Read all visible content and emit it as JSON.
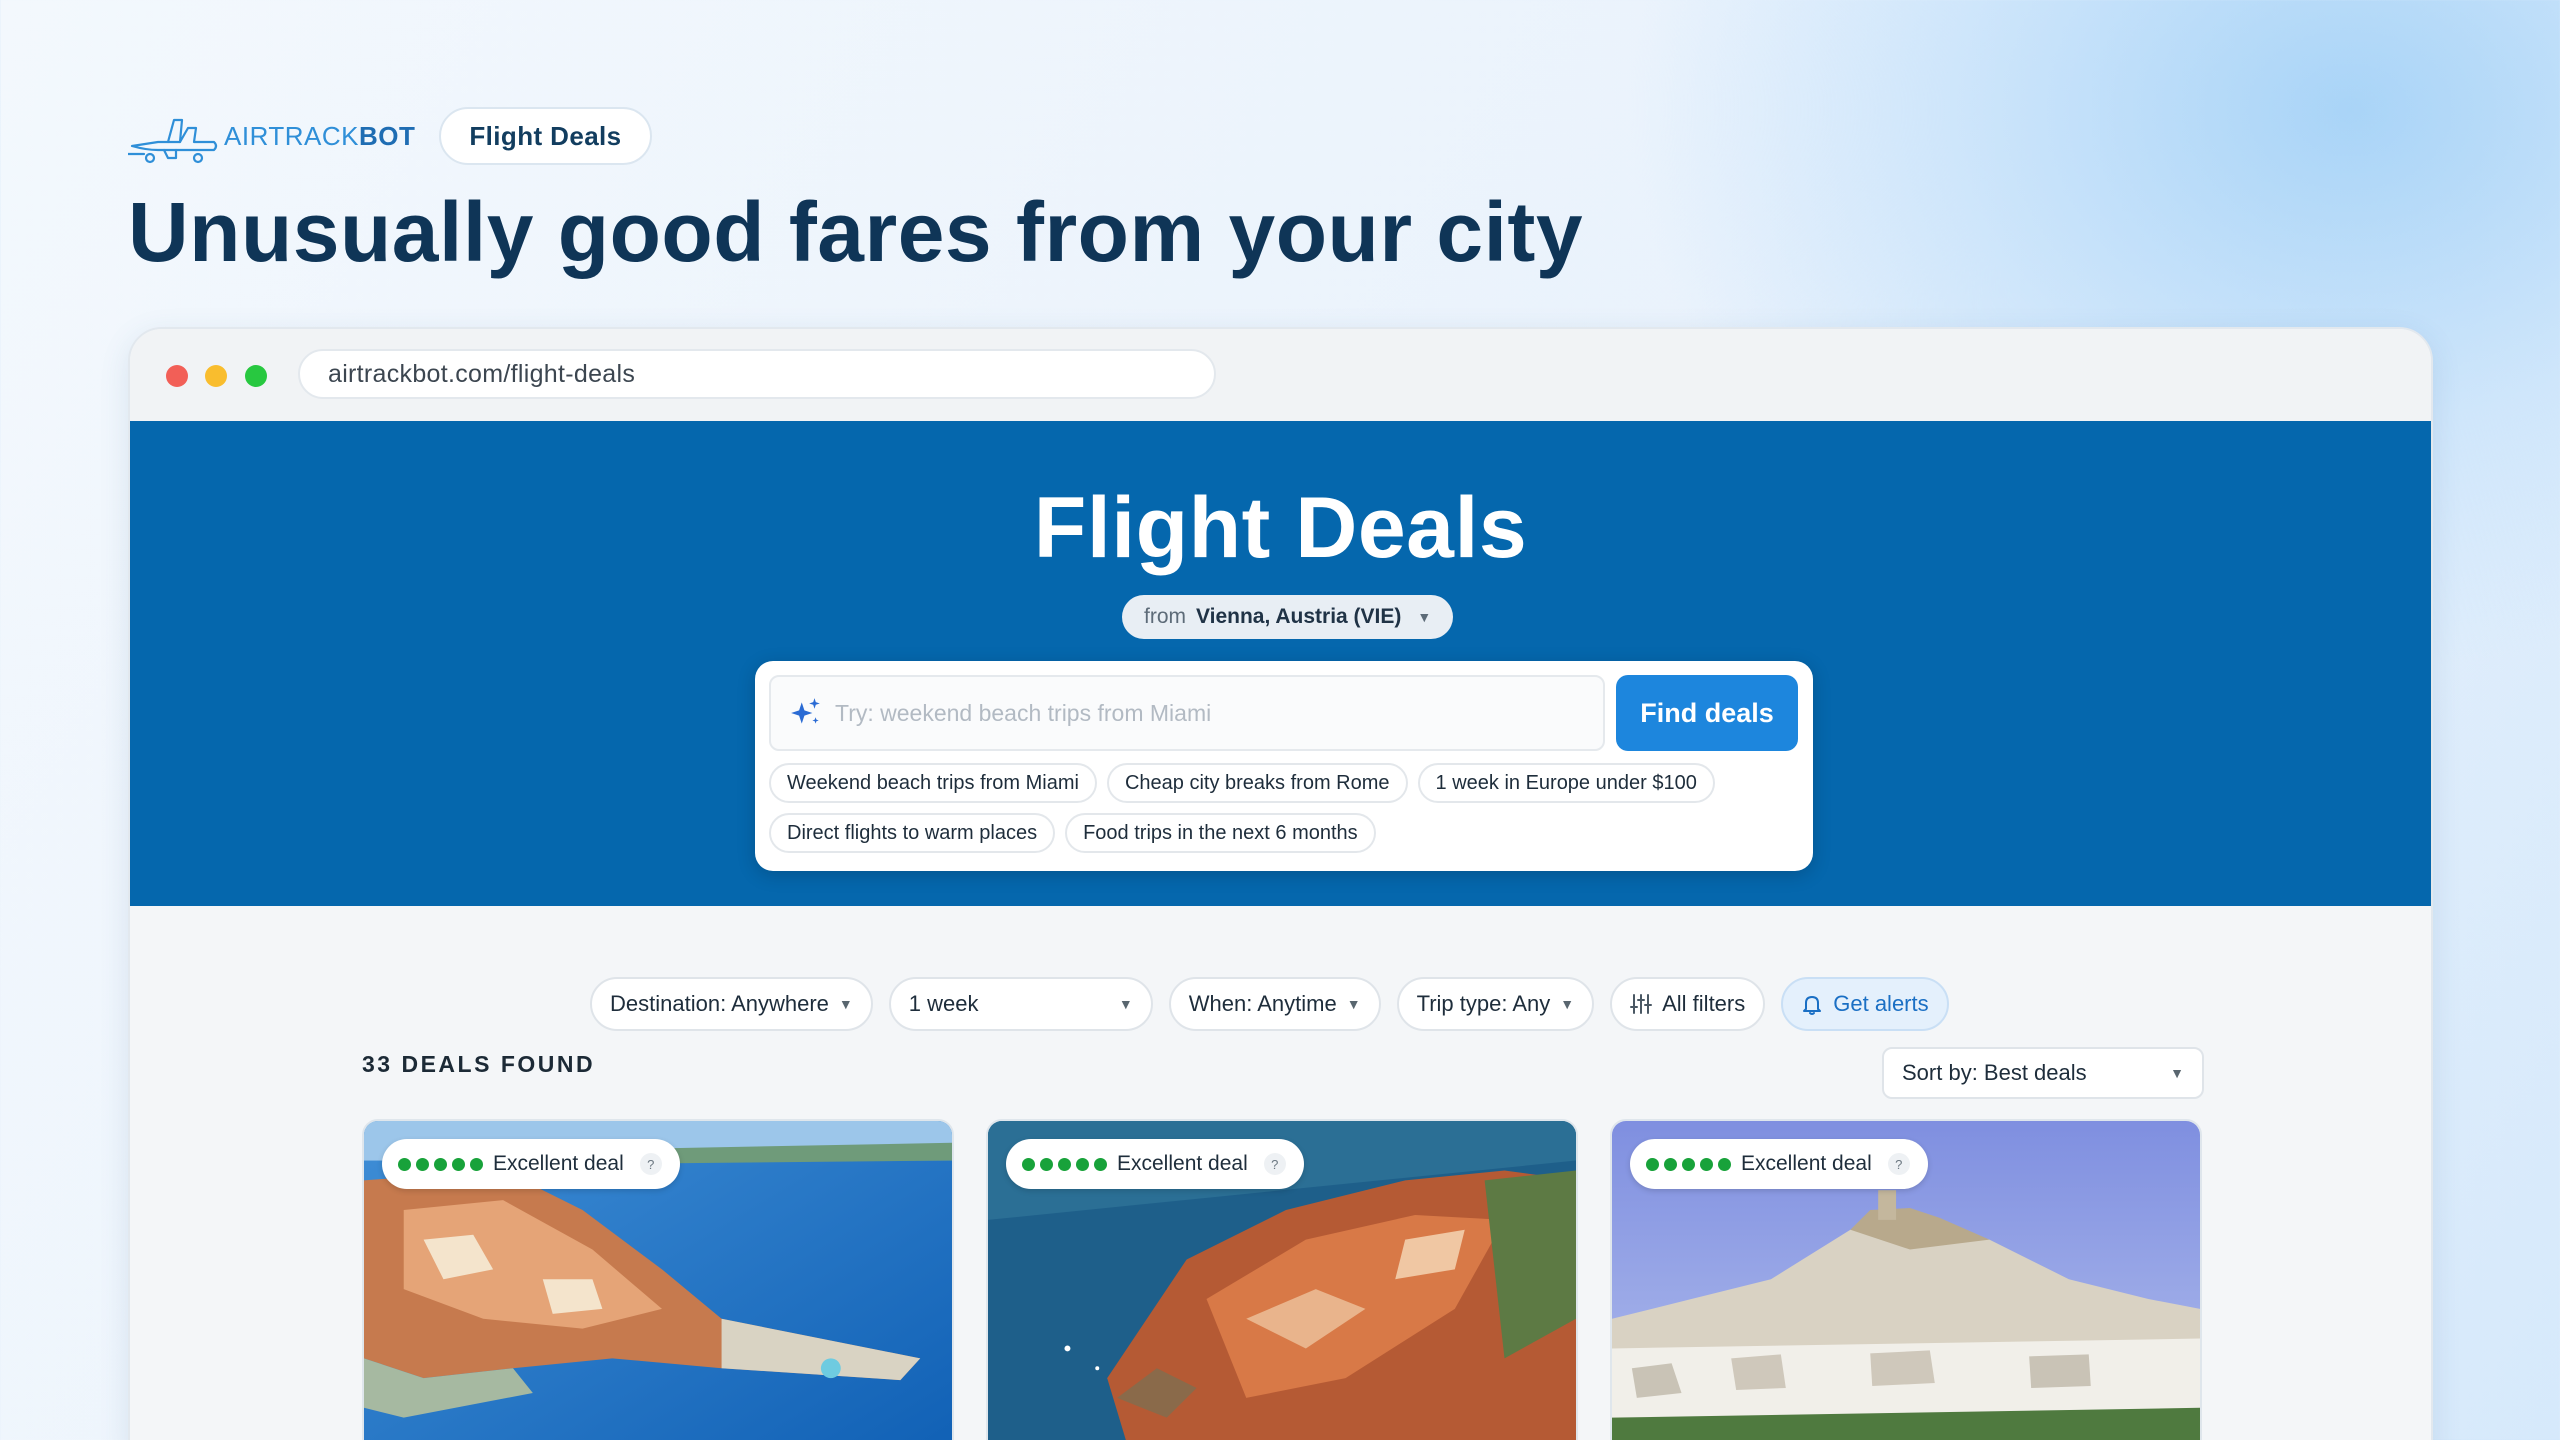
{
  "brand": {
    "name_light": "AIRTRACK",
    "name_bold": "BOT",
    "pill_label": "Flight Deals"
  },
  "hero": {
    "title": "Unusually good fares from your city"
  },
  "browser": {
    "url": "airtrackbot.com/flight-deals"
  },
  "site": {
    "title": "Flight Deals",
    "origin_prefix": "from",
    "origin_city": "Vienna, Austria (VIE)",
    "search_placeholder": "Try: weekend beach trips from Miami",
    "find_button": "Find deals",
    "suggestions": [
      "Weekend beach trips from Miami",
      "Cheap city breaks from Rome",
      "1 week in Europe under $100",
      "Direct flights to warm places",
      "Food trips in the next 6 months"
    ]
  },
  "filters": {
    "destination": "Destination: Anywhere",
    "duration": "1 week",
    "when": "When: Anytime",
    "trip_type": "Trip type: Any",
    "all_filters": "All filters",
    "alerts": "Get alerts"
  },
  "results": {
    "count_label": "33 DEALS FOUND",
    "sort_label": "Sort by: Best deals",
    "cards": [
      {
        "badge": "Excellent deal",
        "help": "?",
        "rating": 5
      },
      {
        "badge": "Excellent deal",
        "help": "?",
        "rating": 5
      },
      {
        "badge": "Excellent deal",
        "help": "?",
        "rating": 5
      }
    ]
  },
  "colors": {
    "hero_blue": "#0567ad",
    "button_blue": "#1d86dd",
    "deal_green": "#18a23a",
    "heading_navy": "#0f3557"
  },
  "icons": [
    "plane-logo-icon",
    "sparkle-icon",
    "chevron-down-icon",
    "sliders-icon",
    "bell-icon",
    "help-icon"
  ]
}
